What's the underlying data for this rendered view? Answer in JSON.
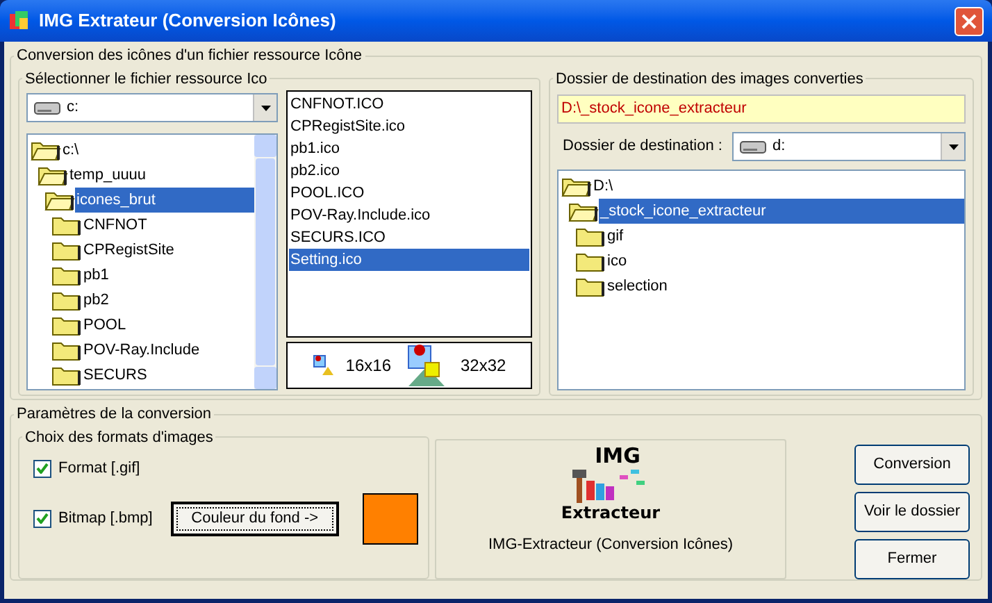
{
  "window": {
    "title": "IMG Extrateur (Conversion Icônes)"
  },
  "main_group": {
    "title": "Conversion des icônes d'un fichier ressource Icône"
  },
  "source": {
    "title": "Sélectionner le fichier ressource Ico",
    "drive": "c:",
    "tree": [
      {
        "label": "c:\\",
        "selected": false,
        "children": [
          {
            "label": "temp_uuuu",
            "selected": false,
            "children": [
              {
                "label": "icones_brut",
                "selected": true,
                "children": [
                  {
                    "label": "CNFNOT",
                    "selected": false
                  },
                  {
                    "label": "CPRegistSite",
                    "selected": false
                  },
                  {
                    "label": "pb1",
                    "selected": false
                  },
                  {
                    "label": "pb2",
                    "selected": false
                  },
                  {
                    "label": "POOL",
                    "selected": false
                  },
                  {
                    "label": "POV-Ray.Include",
                    "selected": false
                  },
                  {
                    "label": "SECURS",
                    "selected": false
                  }
                ]
              }
            ]
          }
        ]
      }
    ],
    "files": [
      {
        "label": "CNFNOT.ICO",
        "selected": false
      },
      {
        "label": "CPRegistSite.ico",
        "selected": false
      },
      {
        "label": "pb1.ico",
        "selected": false
      },
      {
        "label": "pb2.ico",
        "selected": false
      },
      {
        "label": "POOL.ICO",
        "selected": false
      },
      {
        "label": "POV-Ray.Include.ico",
        "selected": false
      },
      {
        "label": "SECURS.ICO",
        "selected": false
      },
      {
        "label": "Setting.ico",
        "selected": true
      }
    ],
    "sizes": [
      "16x16",
      "32x32"
    ]
  },
  "destination": {
    "title": "Dossier de destination des images converties",
    "path": "D:\\_stock_icone_extracteur",
    "label": "Dossier de destination :",
    "drive": "d:",
    "tree": [
      {
        "label": "D:\\",
        "selected": false,
        "children": [
          {
            "label": "_stock_icone_extracteur",
            "selected": true,
            "children": [
              {
                "label": "gif",
                "selected": false
              },
              {
                "label": "ico",
                "selected": false
              },
              {
                "label": "selection",
                "selected": false
              }
            ]
          }
        ]
      }
    ]
  },
  "params": {
    "title": "Paramètres de la conversion",
    "formats_title": "Choix des formats d'images",
    "formats": [
      {
        "label": "Format [.gif]",
        "checked": true
      },
      {
        "label": "Bitmap [.bmp]",
        "checked": true
      }
    ],
    "color_button": "Couleur du fond ->",
    "swatch": {
      "color": "#ff8000"
    },
    "logo_top": "IMG",
    "logo_bottom": "Extracteur",
    "caption": "IMG-Extracteur (Conversion Icônes)"
  },
  "buttons": [
    "Conversion",
    "Voir le dossier",
    "Fermer"
  ]
}
